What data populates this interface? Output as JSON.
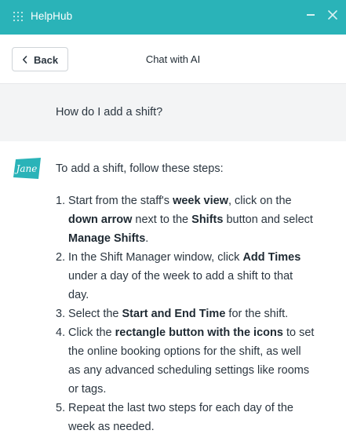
{
  "app": {
    "title": "HelpHub",
    "colors": {
      "titlebar": "#2ab3b8",
      "brand_logo": "#2ab3b8"
    }
  },
  "header": {
    "back_label": "Back",
    "chat_title": "Chat with AI"
  },
  "user_message": {
    "text": "How do I add a shift?"
  },
  "ai_message": {
    "avatar_text": "Jane",
    "intro": "To add a shift, follow these steps:",
    "steps": [
      {
        "number": "1.",
        "parts": [
          {
            "text": "Start from the staff's ",
            "bold": false
          },
          {
            "text": "week view",
            "bold": true
          },
          {
            "text": ", click on the",
            "bold": false
          },
          {
            "br": true
          },
          {
            "text": "down arrow",
            "bold": true
          },
          {
            "text": " next to the ",
            "bold": false
          },
          {
            "text": "Shifts",
            "bold": true
          },
          {
            "text": " button and select",
            "bold": false
          },
          {
            "br": true
          },
          {
            "text": "Manage Shifts",
            "bold": true
          },
          {
            "text": ".",
            "bold": false
          }
        ]
      },
      {
        "number": "2.",
        "parts": [
          {
            "text": "In the Shift Manager window, click ",
            "bold": false
          },
          {
            "text": "Add Times",
            "bold": true
          },
          {
            "br": true
          },
          {
            "text": "under a day of the week to add a shift to that",
            "bold": false
          },
          {
            "br": true
          },
          {
            "text": "day.",
            "bold": false
          }
        ]
      },
      {
        "number": "3.",
        "parts": [
          {
            "text": "Select the ",
            "bold": false
          },
          {
            "text": "Start and End Time",
            "bold": true
          },
          {
            "text": " for the shift.",
            "bold": false
          }
        ]
      },
      {
        "number": "4.",
        "parts": [
          {
            "text": "Click the ",
            "bold": false
          },
          {
            "text": "rectangle button with the icons",
            "bold": true
          },
          {
            "text": " to set",
            "bold": false
          },
          {
            "br": true
          },
          {
            "text": "the online booking options for the shift, as well",
            "bold": false
          },
          {
            "br": true
          },
          {
            "text": "as any advanced scheduling settings like rooms",
            "bold": false
          },
          {
            "br": true
          },
          {
            "text": "or tags.",
            "bold": false
          }
        ]
      },
      {
        "number": "5.",
        "parts": [
          {
            "text": "Repeat the last two steps for each day of the",
            "bold": false
          },
          {
            "br": true
          },
          {
            "text": "week as needed.",
            "bold": false
          }
        ]
      }
    ]
  }
}
